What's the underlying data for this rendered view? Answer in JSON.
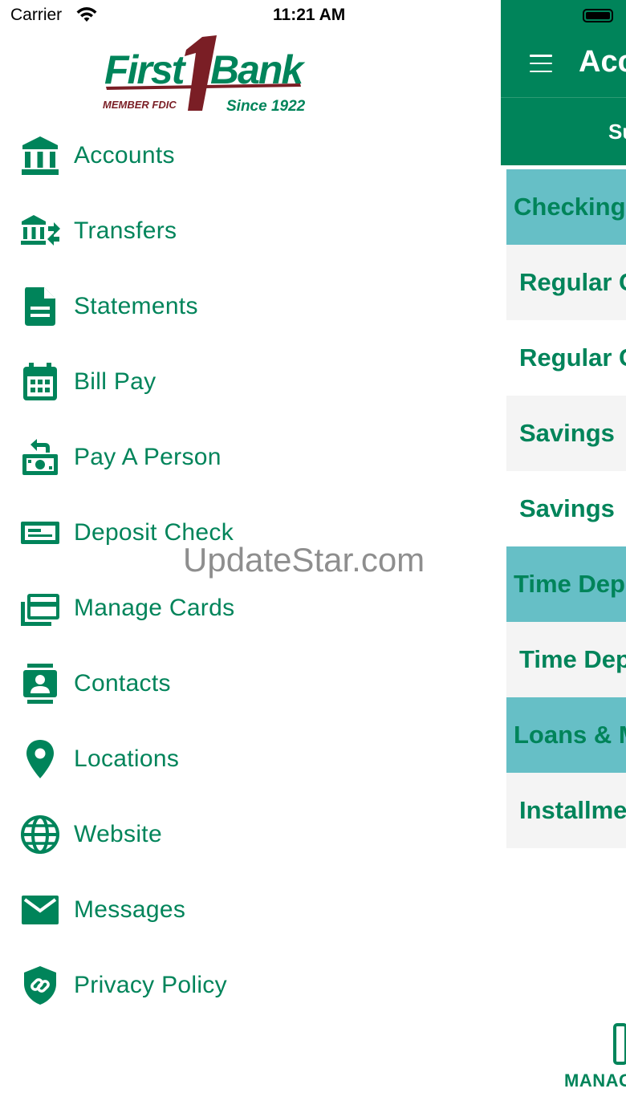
{
  "status_bar": {
    "carrier": "Carrier",
    "time": "11:21 AM"
  },
  "logo": {
    "name": "First1Bank",
    "tagline_left": "MEMBER FDIC",
    "tagline_right": "Since 1922"
  },
  "menu": [
    {
      "label": "Accounts",
      "icon": "bank-icon"
    },
    {
      "label": "Transfers",
      "icon": "bank-transfer-icon"
    },
    {
      "label": "Statements",
      "icon": "document-icon"
    },
    {
      "label": "Bill Pay",
      "icon": "calendar-icon"
    },
    {
      "label": "Pay A Person",
      "icon": "cash-transfer-icon"
    },
    {
      "label": "Deposit Check",
      "icon": "check-icon"
    },
    {
      "label": "Manage Cards",
      "icon": "cards-icon"
    },
    {
      "label": "Contacts",
      "icon": "contact-card-icon"
    },
    {
      "label": "Locations",
      "icon": "map-pin-icon"
    },
    {
      "label": "Website",
      "icon": "globe-icon"
    },
    {
      "label": "Messages",
      "icon": "envelope-icon"
    },
    {
      "label": "Privacy Policy",
      "icon": "shield-link-icon"
    }
  ],
  "background_screen": {
    "title": "Acc",
    "subtab": "Su",
    "rows": [
      {
        "kind": "section",
        "text": "Checking"
      },
      {
        "kind": "account",
        "text": "Regular C"
      },
      {
        "kind": "account",
        "text": "Regular C"
      },
      {
        "kind": "account",
        "text": "Savings"
      },
      {
        "kind": "account",
        "text": "Savings"
      },
      {
        "kind": "section",
        "text": "Time Dep"
      },
      {
        "kind": "account",
        "text": "Time Dep"
      },
      {
        "kind": "section",
        "text": "Loans & M"
      },
      {
        "kind": "account",
        "text": "Installme"
      }
    ],
    "tab_label": "MANAG"
  },
  "watermark": "UpdateStar.com",
  "colors": {
    "brand_green": "#00845a",
    "section_teal": "#66bfc6",
    "row_shade": "#f4f4f4",
    "logo_maroon": "#7a1e25"
  }
}
